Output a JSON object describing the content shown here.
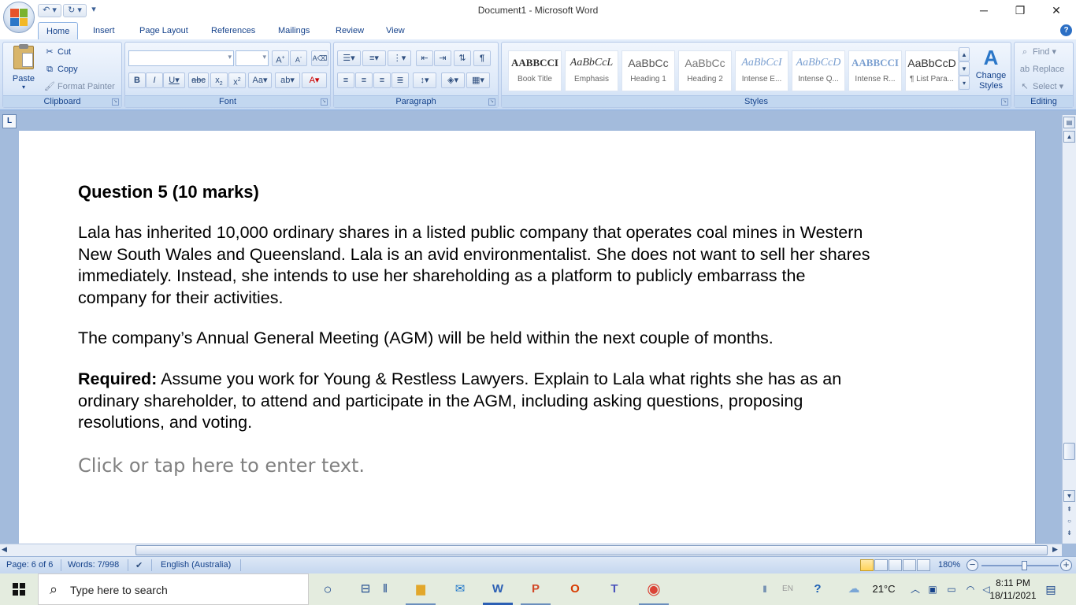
{
  "window": {
    "title": "Document1 - Microsoft Word",
    "minimize": "─",
    "restore": "❐",
    "close": "✕"
  },
  "qat": {
    "undo": "↶ ▾",
    "redo": "↻ ▾",
    "customize": "▾"
  },
  "ribbon": {
    "tabs": [
      "Home",
      "Insert",
      "Page Layout",
      "References",
      "Mailings",
      "Review",
      "View"
    ],
    "active_tab": "Home",
    "clipboard": {
      "label": "Clipboard",
      "paste": "Paste",
      "cut": "Cut",
      "copy": "Copy",
      "format_painter": "Format Painter"
    },
    "font": {
      "label": "Font"
    },
    "paragraph": {
      "label": "Paragraph"
    },
    "styles": {
      "label": "Styles",
      "items": [
        {
          "preview": "AABBCCI",
          "name": "Book Title"
        },
        {
          "preview": "AaBbCcL",
          "name": "Emphasis"
        },
        {
          "preview": "AaBbCc",
          "name": "Heading 1"
        },
        {
          "preview": "AaBbCc",
          "name": "Heading 2"
        },
        {
          "preview": "AaBbCcI",
          "name": "Intense E..."
        },
        {
          "preview": "AaBbCcD",
          "name": "Intense Q..."
        },
        {
          "preview": "AABBCCI",
          "name": "Intense R..."
        },
        {
          "preview": "AaBbCcD",
          "name": "¶ List Para..."
        }
      ],
      "change_styles": "Change Styles"
    },
    "editing": {
      "label": "Editing",
      "find": "Find",
      "replace": "Replace",
      "select": "Select"
    }
  },
  "document": {
    "heading": "Question 5 (10 marks)",
    "para1": "Lala has inherited 10,000 ordinary shares in a listed public company that operates coal mines in Western New South Wales and Queensland. Lala is an avid environmentalist. She does not want to sell her shares immediately. Instead, she intends to use her shareholding as a platform to publicly embarrass the company for their activities.",
    "para2": "The company’s Annual General Meeting (AGM) will be held within the next couple of months.",
    "para3_label": "Required:",
    "para3": " Assume you work for Young & Restless Lawyers. Explain to Lala what rights she has as an ordinary shareholder, to attend and participate in the AGM, including asking questions, proposing resolutions, and voting.",
    "placeholder": "Click or tap here to enter text."
  },
  "statusbar": {
    "page": "Page: 6 of 6",
    "words": "Words: 7/998",
    "language": "English (Australia)",
    "zoom": "180%"
  },
  "taskbar": {
    "search_placeholder": "Type here to search",
    "lang": "EN",
    "weather": "21°C",
    "time": "8:11 PM",
    "date": "18/11/2021"
  }
}
